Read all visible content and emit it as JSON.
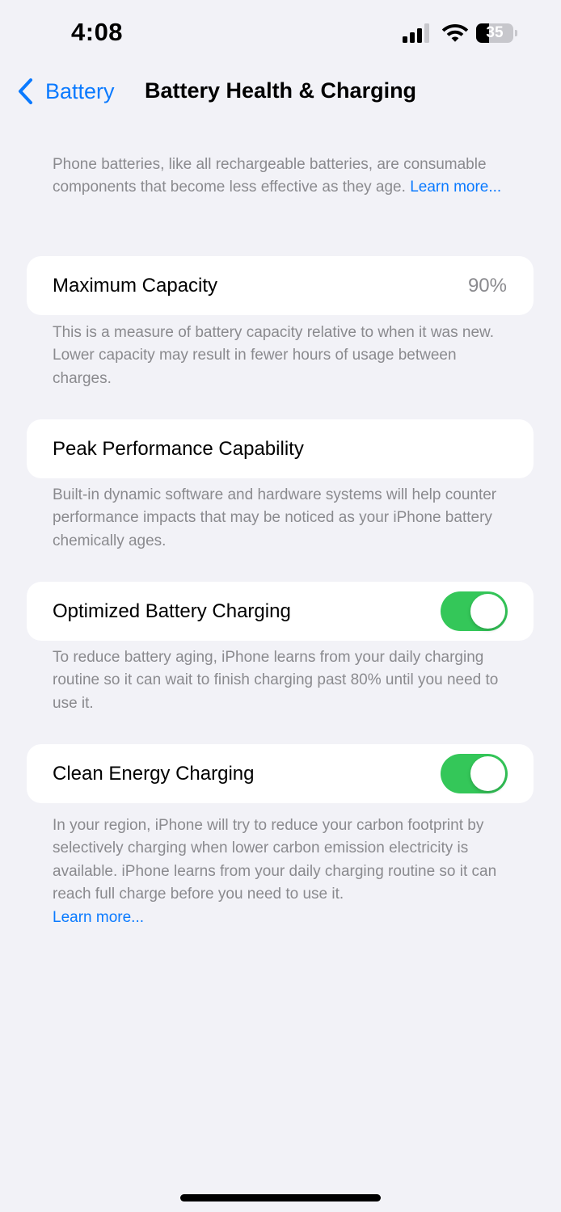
{
  "status_bar": {
    "time": "4:08",
    "battery_level": "35",
    "battery_fraction": 0.35,
    "signal_bars_active": 3,
    "signal_bars_total": 4,
    "icons": [
      "cellular-signal-icon",
      "wifi-icon",
      "battery-icon"
    ]
  },
  "nav": {
    "back_label": "Battery",
    "back_icon": "chevron-left-icon",
    "title": "Battery Health & Charging"
  },
  "intro": {
    "text": "Phone batteries, like all rechargeable batteries, are consumable components that become less effective as they age.",
    "link": "Learn more..."
  },
  "sections": {
    "max_capacity": {
      "label": "Maximum Capacity",
      "value": "90%",
      "footnote": "This is a measure of battery capacity relative to when it was new. Lower capacity may result in fewer hours of usage between charges."
    },
    "peak_performance": {
      "label": "Peak Performance Capability",
      "footnote": "Built-in dynamic software and hardware systems will help counter performance impacts that may be noticed as your iPhone battery chemically ages."
    },
    "optimized_charging": {
      "label": "Optimized Battery Charging",
      "enabled": true,
      "footnote": "To reduce battery aging, iPhone learns from your daily charging routine so it can wait to finish charging past 80% until you need to use it."
    },
    "clean_energy": {
      "label": "Clean Energy Charging",
      "enabled": true,
      "footnote": "In your region, iPhone will try to reduce your carbon footprint by selectively charging when lower carbon emission electricity is available. iPhone learns from your daily charging routine so it can reach full charge before you need to use it.",
      "link": "Learn more..."
    }
  },
  "colors": {
    "accent": "#0a7aff",
    "toggle_on": "#34c759",
    "background": "#f2f2f7",
    "secondary_text": "#8a8a8e"
  }
}
